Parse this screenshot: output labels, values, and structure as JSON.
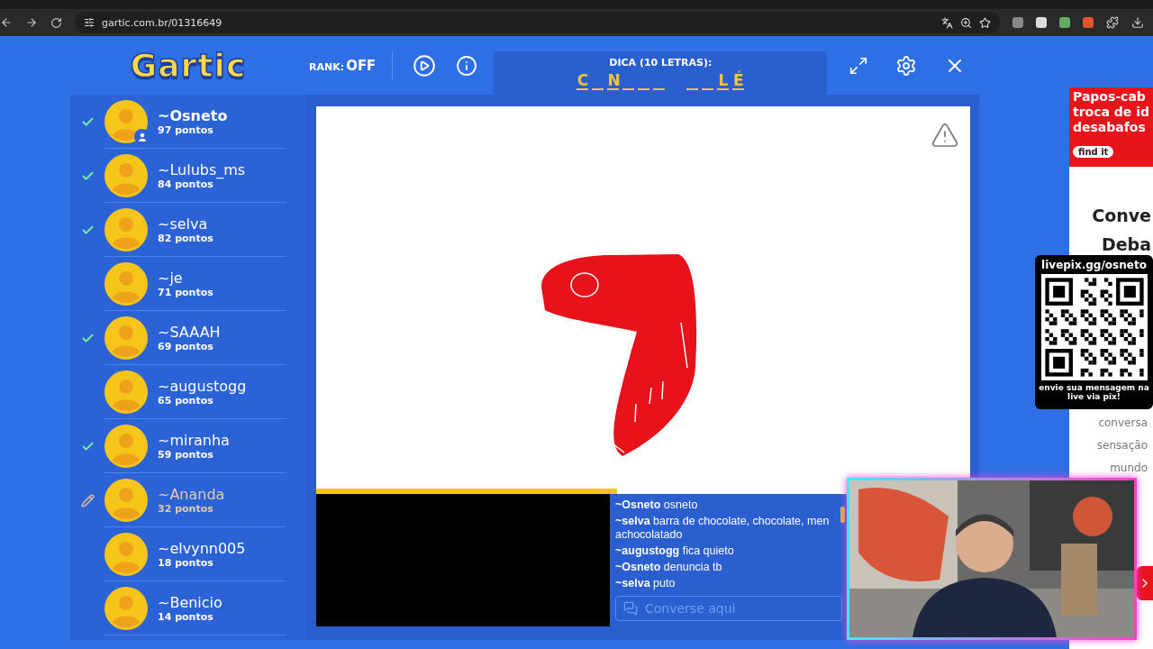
{
  "browser": {
    "url": "gartic.com.br/01316649"
  },
  "header": {
    "logo": "Gartic",
    "rank_label": "RANK:",
    "rank_value": "OFF",
    "hint": {
      "label": "DICA (10 LETRAS):",
      "words": [
        [
          {
            "kind": "letter",
            "letter": "C"
          },
          {
            "kind": "blank"
          },
          {
            "kind": "letter",
            "letter": "N"
          },
          {
            "kind": "blank"
          },
          {
            "kind": "blank"
          },
          {
            "kind": "blank"
          }
        ],
        [
          {
            "kind": "blank"
          },
          {
            "kind": "blank"
          },
          {
            "kind": "letter",
            "letter": "L"
          },
          {
            "kind": "letter",
            "letter": "É"
          }
        ]
      ]
    }
  },
  "players": [
    {
      "name": "~Osneto",
      "points": "97 pontos",
      "guessed": true,
      "drawing": false,
      "you": true
    },
    {
      "name": "~Lulubs_ms",
      "points": "84 pontos",
      "guessed": true,
      "drawing": false,
      "you": false
    },
    {
      "name": "~selva",
      "points": "82 pontos",
      "guessed": true,
      "drawing": false,
      "you": false
    },
    {
      "name": "~je",
      "points": "71 pontos",
      "guessed": false,
      "drawing": false,
      "you": false
    },
    {
      "name": "~SAAAH",
      "points": "69 pontos",
      "guessed": true,
      "drawing": false,
      "you": false
    },
    {
      "name": "~augustogg",
      "points": "65 pontos",
      "guessed": false,
      "drawing": false,
      "you": false
    },
    {
      "name": "~miranha",
      "points": "59 pontos",
      "guessed": true,
      "drawing": false,
      "you": false
    },
    {
      "name": "~Ananda",
      "points": "32 pontos",
      "guessed": false,
      "drawing": true,
      "you": false
    },
    {
      "name": "~elvynn005",
      "points": "18 pontos",
      "guessed": false,
      "drawing": false,
      "you": false
    },
    {
      "name": "~Benicio",
      "points": "14 pontos",
      "guessed": false,
      "drawing": false,
      "you": false
    }
  ],
  "progress": {
    "level": 0.46
  },
  "chat": {
    "messages": [
      {
        "author": "~Osneto",
        "text": "osneto"
      },
      {
        "author": "~selva",
        "text": "barra de chocolate, chocolate, men achocolatado"
      },
      {
        "author": "~augustogg",
        "text": "fica quieto"
      },
      {
        "author": "~Osneto",
        "text": "denuncia tb"
      },
      {
        "author": "~selva",
        "text": "puto"
      }
    ],
    "placeholder": "Converse aqui"
  },
  "ad": {
    "banner_lines": [
      "Papos-cab",
      "troca de id",
      "desabafos"
    ],
    "button": "find it",
    "headline_lines": [
      "Conve",
      "Deba"
    ],
    "body_lines": [
      "conversa",
      "sensação",
      "mundo"
    ]
  },
  "qr_overlay": {
    "title": "livepix.gg/osneto",
    "caption": "envie sua mensagem na live via pix!"
  }
}
